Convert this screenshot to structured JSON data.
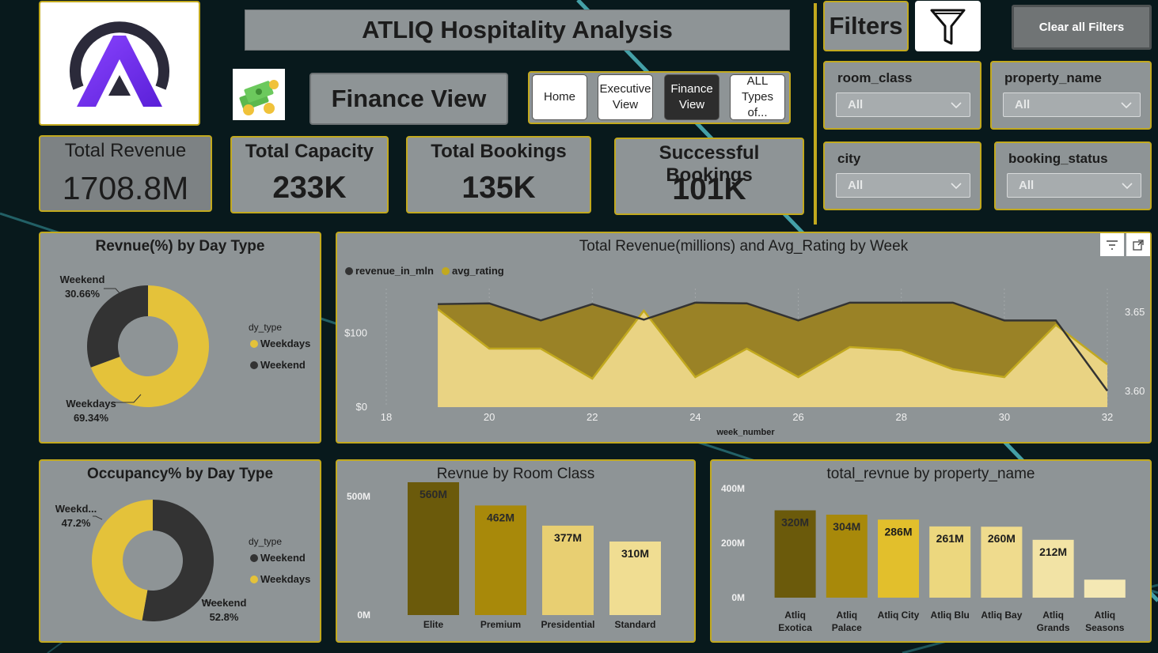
{
  "header": {
    "title": "ATLIQ Hospitality Analysis",
    "view_title": "Finance View",
    "nav": [
      {
        "label": "Home"
      },
      {
        "label": "Executive View"
      },
      {
        "label": "Finance View"
      },
      {
        "label": "ALL Types of..."
      }
    ]
  },
  "filters": {
    "heading": "Filters",
    "clear_label": "Clear all Filters",
    "slicers": [
      {
        "field": "room_class",
        "value": "All"
      },
      {
        "field": "property_name",
        "value": "All"
      },
      {
        "field": "city",
        "value": "All"
      },
      {
        "field": "booking_status",
        "value": "All"
      }
    ]
  },
  "kpis": [
    {
      "label": "Total Revenue",
      "value": "1708.8M"
    },
    {
      "label": "Total Capacity",
      "value": "233K"
    },
    {
      "label": "Total Bookings",
      "value": "135K"
    },
    {
      "label": "Successful Bookings",
      "value": "101K"
    }
  ],
  "colors": {
    "background": "#08191c",
    "card": "#8e9496",
    "border": "#c2a91e",
    "gold": "#e4c23a",
    "dark": "#333333"
  },
  "chart_data": [
    {
      "type": "pie",
      "title": "Revnue(%) by Day Type",
      "legend_title": "dy_type",
      "legend": [
        "Weekdays",
        "Weekend"
      ],
      "slices": [
        {
          "name": "Weekdays",
          "value": 69.34,
          "label": "69.34%",
          "color": "#e4c23a"
        },
        {
          "name": "Weekend",
          "value": 30.66,
          "label": "30.66%",
          "color": "#333333"
        }
      ]
    },
    {
      "type": "line",
      "title": "Total Revenue(millions) and Avg_Rating by Week",
      "xlabel": "week_number",
      "series": [
        {
          "name": "revenue_in_mln",
          "color": "#333333",
          "x": [
            19,
            20,
            21,
            22,
            23,
            24,
            25,
            26,
            27,
            28,
            29,
            30,
            31,
            32
          ],
          "values": [
            139,
            140,
            117,
            139,
            118,
            141,
            140,
            117,
            141,
            141,
            141,
            117,
            117,
            22
          ]
        },
        {
          "name": "avg_rating",
          "color": "#c2a91e",
          "x": [
            19,
            20,
            21,
            22,
            23,
            24,
            25,
            26,
            27,
            28,
            29,
            30,
            31,
            32
          ],
          "values": [
            3.652,
            3.627,
            3.627,
            3.608,
            3.651,
            3.609,
            3.627,
            3.609,
            3.628,
            3.626,
            3.614,
            3.609,
            3.642,
            3.617
          ]
        }
      ],
      "xticks": [
        18,
        20,
        22,
        24,
        26,
        28,
        30,
        32
      ],
      "yticks_left": [
        {
          "v": 0,
          "label": "$0"
        },
        {
          "v": 100,
          "label": "$100"
        }
      ],
      "yticks_right": [
        {
          "v": 3.6,
          "label": "3.60"
        },
        {
          "v": 3.65,
          "label": "3.65"
        }
      ],
      "ylim_left": [
        0,
        160
      ],
      "ylim_right": [
        3.59,
        3.665
      ]
    },
    {
      "type": "pie",
      "title": "Occupancy% by Day Type",
      "legend_title": "dy_type",
      "legend": [
        "Weekend",
        "Weekdays"
      ],
      "slices": [
        {
          "name": "Weekend",
          "value": 52.8,
          "label": "52.8%",
          "color": "#333333"
        },
        {
          "name": "Weekdays",
          "value": 47.2,
          "label": "47.2%",
          "display": "Weekd...",
          "color": "#e4c23a"
        }
      ]
    },
    {
      "type": "bar",
      "title": "Revnue by Room Class",
      "categories": [
        "Elite",
        "Premium",
        "Presidential",
        "Standard"
      ],
      "values": [
        560,
        462,
        377,
        310
      ],
      "labels": [
        "560M",
        "462M",
        "377M",
        "310M"
      ],
      "colors": [
        "#6b5a0b",
        "#a8890a",
        "#e8cf72",
        "#f0dd92"
      ],
      "yticks": [
        {
          "v": 0,
          "label": "0M"
        },
        {
          "v": 500,
          "label": "500M"
        }
      ],
      "ylim": [
        0,
        600
      ]
    },
    {
      "type": "bar",
      "title": "total_revnue by property_name",
      "categories": [
        "Atliq Exotica",
        "Atliq Palace",
        "Atliq City",
        "Atliq Blu",
        "Atliq Bay",
        "Atliq Grands",
        "Atliq Seasons"
      ],
      "values": [
        320,
        304,
        286,
        261,
        260,
        212,
        66
      ],
      "labels": [
        "320M",
        "304M",
        "286M",
        "261M",
        "260M",
        "212M",
        ""
      ],
      "colors": [
        "#6b5a0b",
        "#a8890a",
        "#e2bf2c",
        "#ecd77e",
        "#efdb8d",
        "#f2e3a5",
        "#f4e8b4"
      ],
      "yticks": [
        {
          "v": 0,
          "label": "0M"
        },
        {
          "v": 200,
          "label": "200M"
        },
        {
          "v": 400,
          "label": "400M"
        }
      ],
      "ylim": [
        0,
        420
      ]
    }
  ]
}
